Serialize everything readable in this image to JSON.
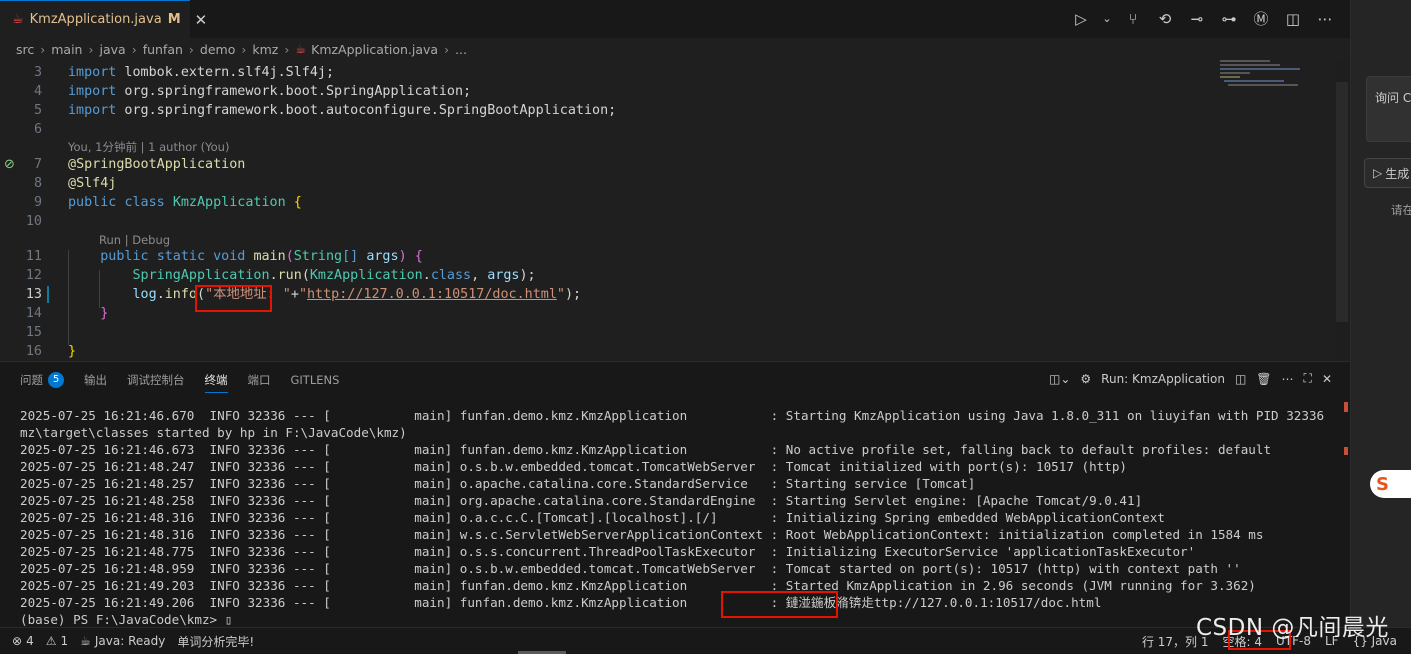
{
  "tab": {
    "filename": "KmzApplication.java",
    "modified": "M",
    "close": "✕"
  },
  "breadcrumb": [
    "src",
    "main",
    "java",
    "funfan",
    "demo",
    "kmz",
    "KmzApplication.java",
    "..."
  ],
  "editor": {
    "lines": [
      {
        "num": "3",
        "tokens": [
          [
            "kw",
            "import"
          ],
          [
            "pl",
            " lombok.extern.slf4j.Slf4j;"
          ]
        ]
      },
      {
        "num": "4",
        "tokens": [
          [
            "kw",
            "import"
          ],
          [
            "pl",
            " org.springframework.boot.SpringApplication;"
          ]
        ]
      },
      {
        "num": "5",
        "tokens": [
          [
            "kw",
            "import"
          ],
          [
            "pl",
            " org.springframework.boot.autoconfigure.SpringBootApplication;"
          ]
        ]
      },
      {
        "num": "6",
        "tokens": []
      },
      {
        "num": "7",
        "tokens": [
          [
            "an",
            "@"
          ],
          [
            "an",
            "SpringBootApplication"
          ]
        ]
      },
      {
        "num": "8",
        "tokens": [
          [
            "an",
            "@"
          ],
          [
            "an",
            "Slf4j"
          ]
        ]
      },
      {
        "num": "9",
        "tokens": [
          [
            "kw",
            "public"
          ],
          [
            "pl",
            " "
          ],
          [
            "kw",
            "class"
          ],
          [
            "pl",
            " "
          ],
          [
            "ty",
            "KmzApplication"
          ],
          [
            "pl",
            " "
          ],
          [
            "br",
            "{"
          ]
        ]
      },
      {
        "num": "10",
        "tokens": []
      },
      {
        "num": "11",
        "tokens": [
          [
            "pl",
            "    "
          ],
          [
            "kw",
            "public"
          ],
          [
            "pl",
            " "
          ],
          [
            "kw",
            "static"
          ],
          [
            "pl",
            " "
          ],
          [
            "kw",
            "void"
          ],
          [
            "pl",
            " "
          ],
          [
            "fn",
            "main"
          ],
          [
            "br2",
            "("
          ],
          [
            "ty",
            "String"
          ],
          [
            "kw",
            "[]"
          ],
          [
            "pl",
            " "
          ],
          [
            "va",
            "args"
          ],
          [
            "br2",
            ")"
          ],
          [
            "pl",
            " "
          ],
          [
            "br2",
            "{"
          ]
        ]
      },
      {
        "num": "12",
        "tokens": [
          [
            "pl",
            "        "
          ],
          [
            "ty",
            "SpringApplication"
          ],
          [
            "pl",
            "."
          ],
          [
            "fn",
            "run"
          ],
          [
            "pl",
            "("
          ],
          [
            "ty",
            "KmzApplication"
          ],
          [
            "pl",
            "."
          ],
          [
            "kw",
            "class"
          ],
          [
            "pl",
            ", "
          ],
          [
            "va",
            "args"
          ],
          [
            "pl",
            ");"
          ]
        ]
      },
      {
        "num": "13",
        "tokens": [
          [
            "pl",
            "        "
          ],
          [
            "va",
            "log"
          ],
          [
            "pl",
            "."
          ],
          [
            "fn",
            "info"
          ],
          [
            "pl",
            "("
          ],
          [
            "str",
            "\"本地地址: \""
          ],
          [
            "pl",
            "+"
          ],
          [
            "str",
            "\""
          ],
          [
            "url",
            "http://127.0.0.1:10517/doc.html"
          ],
          [
            "str",
            "\""
          ],
          [
            "pl",
            ");"
          ]
        ]
      },
      {
        "num": "14",
        "tokens": [
          [
            "pl",
            "    "
          ],
          [
            "br2",
            "}"
          ]
        ]
      },
      {
        "num": "15",
        "tokens": []
      },
      {
        "num": "16",
        "tokens": [
          [
            "br",
            "}"
          ]
        ]
      }
    ],
    "codelens_author": "You, 1分钟前 | 1 author (You)",
    "codelens_run": "Run | Debug"
  },
  "right_pane": {
    "ask": "询问 C",
    "generate": "生成",
    "hint": "请在"
  },
  "panel": {
    "tabs": [
      {
        "label": "问题",
        "badge": "5"
      },
      {
        "label": "输出"
      },
      {
        "label": "调试控制台"
      },
      {
        "label": "终端",
        "active": true
      },
      {
        "label": "端口"
      },
      {
        "label": "GITLENS"
      }
    ],
    "run_label": "Run: KmzApplication",
    "terminal": [
      "2025-07-25 16:21:46.670  INFO 32336 --- [           main] funfan.demo.kmz.KmzApplication           : Starting KmzApplication using Java 1.8.0_311 on liuyifan with PID 32336 (F:\\JavaCode\\k",
      "mz\\target\\classes started by hp in F:\\JavaCode\\kmz)",
      "2025-07-25 16:21:46.673  INFO 32336 --- [           main] funfan.demo.kmz.KmzApplication           : No active profile set, falling back to default profiles: default",
      "2025-07-25 16:21:48.247  INFO 32336 --- [           main] o.s.b.w.embedded.tomcat.TomcatWebServer  : Tomcat initialized with port(s): 10517 (http)",
      "2025-07-25 16:21:48.257  INFO 32336 --- [           main] o.apache.catalina.core.StandardService   : Starting service [Tomcat]",
      "2025-07-25 16:21:48.258  INFO 32336 --- [           main] org.apache.catalina.core.StandardEngine  : Starting Servlet engine: [Apache Tomcat/9.0.41]",
      "2025-07-25 16:21:48.316  INFO 32336 --- [           main] o.a.c.c.C.[Tomcat].[localhost].[/]       : Initializing Spring embedded WebApplicationContext",
      "2025-07-25 16:21:48.316  INFO 32336 --- [           main] w.s.c.ServletWebServerApplicationContext : Root WebApplicationContext: initialization completed in 1584 ms",
      "2025-07-25 16:21:48.775  INFO 32336 --- [           main] o.s.s.concurrent.ThreadPoolTaskExecutor  : Initializing ExecutorService 'applicationTaskExecutor'",
      "2025-07-25 16:21:48.959  INFO 32336 --- [           main] o.s.b.w.embedded.tomcat.TomcatWebServer  : Tomcat started on port(s): 10517 (http) with context path ''",
      "2025-07-25 16:21:49.203  INFO 32336 --- [           main] funfan.demo.kmz.KmzApplication           : Started KmzApplication in 2.96 seconds (JVM running for 3.362)",
      "2025-07-25 16:21:49.206  INFO 32336 --- [           main] funfan.demo.kmz.KmzApplication           : 鏈湴鍦板潃锛歨ttp://127.0.0.1:10517/doc.html",
      "(base) PS F:\\JavaCode\\kmz> ▯"
    ]
  },
  "statusbar": {
    "left": [
      {
        "icon": "⊗",
        "text": "4"
      },
      {
        "icon": "⚠",
        "text": "1"
      },
      {
        "icon": "☕",
        "text": "Java: Ready"
      },
      {
        "icon": "",
        "text": "单词分析完毕!"
      }
    ],
    "right": [
      "行 17，列 1",
      "空格: 4",
      "UTF-8",
      "LF",
      "{} Java"
    ]
  },
  "watermark": "CSDN @凡间晨光",
  "colors": {
    "accent": "#0078d4",
    "highlight_box": "#e51400"
  }
}
